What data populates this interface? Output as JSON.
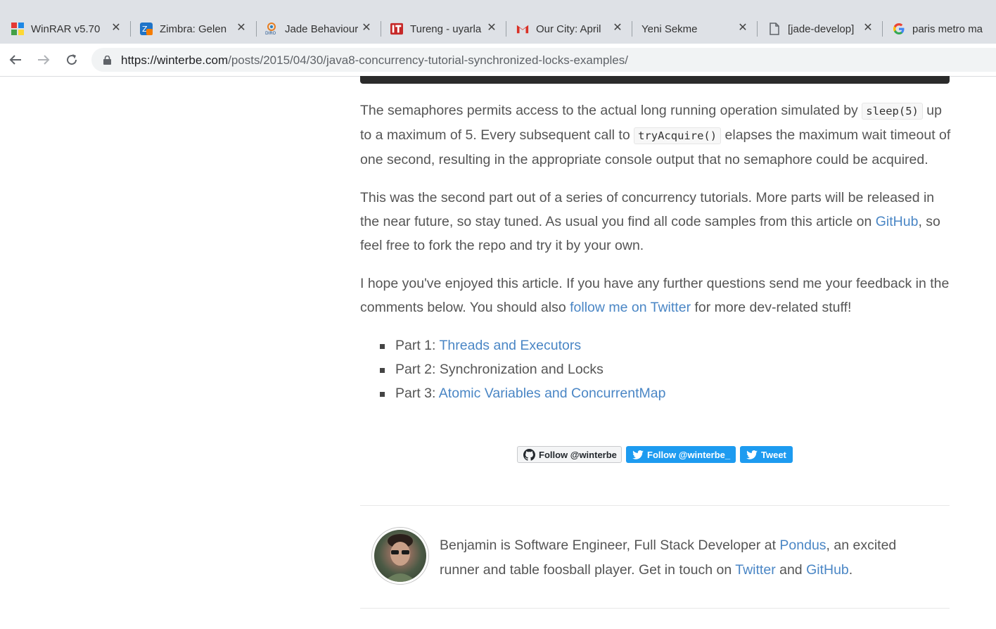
{
  "browser": {
    "tabs": [
      {
        "title": "WinRAR v5.70",
        "icon": "winrar-icon"
      },
      {
        "title": "Zimbra: Gelen",
        "icon": "zimbra-icon"
      },
      {
        "title": "Jade Behaviour",
        "icon": "diro-icon"
      },
      {
        "title": "Tureng - uyarla",
        "icon": "tureng-icon"
      },
      {
        "title": "Our City: April",
        "icon": "gmail-icon"
      },
      {
        "title": "Yeni Sekme",
        "icon": ""
      },
      {
        "title": "[jade-develop]",
        "icon": "document-icon"
      },
      {
        "title": "paris metro ma",
        "icon": "google-icon"
      }
    ],
    "url_domain": "https://winterbe.com",
    "url_path": "/posts/2015/04/30/java8-concurrency-tutorial-synchronized-locks-examples/"
  },
  "article": {
    "p1": {
      "t1": "The semaphores permits access to the actual long running operation simulated by ",
      "code1": "sleep(5)",
      "t2": " up to a maximum of 5. Every subsequent call to ",
      "code2": "tryAcquire()",
      "t3": " elapses the maximum wait timeout of one second, resulting in the appropriate console output that no semaphore could be acquired."
    },
    "p2": {
      "t1": "This was the second part out of a series of concurrency tutorials. More parts will be released in the near future, so stay tuned. As usual you find all code samples from this article on ",
      "link": "GitHub",
      "t2": ", so feel free to fork the repo and try it by your own."
    },
    "p3": {
      "t1": "I hope you've enjoyed this article. If you have any further questions send me your feedback in the comments below. You should also ",
      "link": "follow me on Twitter",
      "t2": " for more dev-related stuff!"
    },
    "parts": [
      {
        "prefix": "Part 1: ",
        "link": "Threads and Executors",
        "text": ""
      },
      {
        "prefix": "Part 2: Synchronization and Locks",
        "link": "",
        "text": ""
      },
      {
        "prefix": "Part 3: ",
        "link": "Atomic Variables and ConcurrentMap",
        "text": ""
      }
    ]
  },
  "social": {
    "github_follow": "Follow @winterbe",
    "twitter_follow": "Follow @winterbe_",
    "tweet": "Tweet"
  },
  "author": {
    "t1": "Benjamin is Software Engineer, Full Stack Developer at ",
    "link1": "Pondus",
    "t2": ", an excited runner and table foosball player. Get in touch on ",
    "link2": "Twitter",
    "t3": " and ",
    "link3": "GitHub",
    "t4": "."
  },
  "colors": {
    "link": "#4a86c5",
    "twitter": "#1d9bf0",
    "tabstrip": "#dee1e6"
  }
}
